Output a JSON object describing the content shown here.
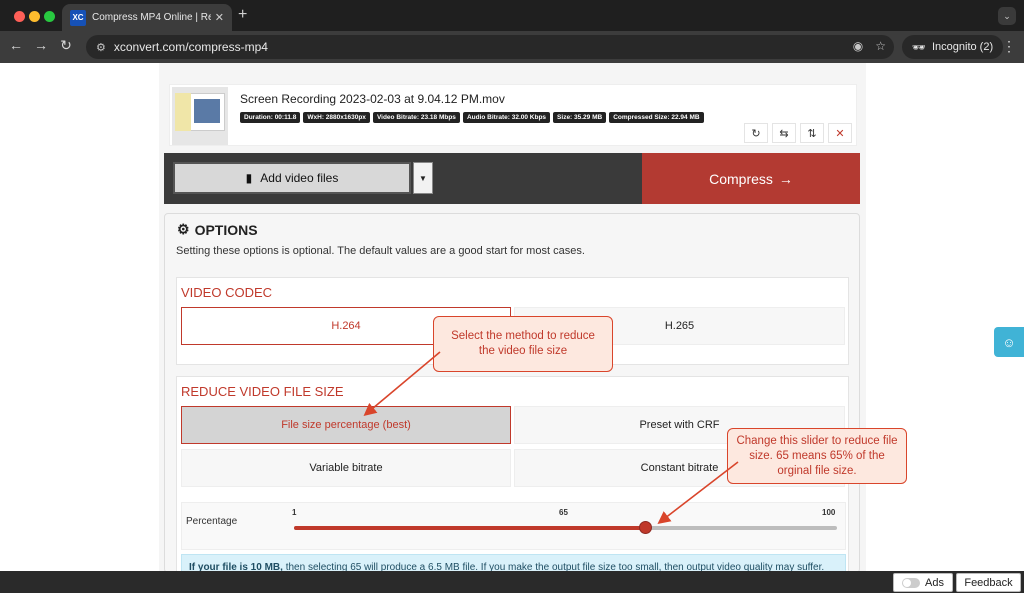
{
  "browser": {
    "tab_title": "Compress MP4 Online | Redu",
    "favicon_text": "XC",
    "url": "xconvert.com/compress-mp4",
    "incognito_label": "Incognito (2)"
  },
  "file": {
    "name": "Screen Recording 2023-02-03 at 9.04.12 PM.mov",
    "badges": [
      "Duration: 00:11.8",
      "WxH: 2880x1630px",
      "Video Bitrate: 23.18 Mbps",
      "Audio Bitrate: 32.00 Kbps",
      "Size: 35.29 MB",
      "Compressed Size: 22.94 MB"
    ]
  },
  "actions": {
    "add_label": "Add video files",
    "compress_label": "Compress"
  },
  "options": {
    "title": "OPTIONS",
    "subtitle": "Setting these options is optional. The default values are a good start for most cases.",
    "codec_title": "VIDEO CODEC",
    "codec_options": [
      "H.264",
      "H.265"
    ],
    "reduce_title": "REDUCE VIDEO FILE SIZE",
    "reduce_options": [
      "File size percentage (best)",
      "Preset with CRF",
      "Variable bitrate",
      "Constant bitrate"
    ],
    "slider": {
      "label": "Percentage",
      "min_label": "1",
      "mid_label": "65",
      "max_label": "100",
      "min": 1,
      "max": 100,
      "value": 65
    },
    "info_bold": "If your file is 10 MB,",
    "info_text": " then selecting 65 will produce a 6.5 MB file. If you make the output file size too small, then output video quality may suffer."
  },
  "annotations": {
    "callout_1": "Select the method to reduce the video file size",
    "callout_2": "Change this slider to reduce file size. 65 means 65% of the orginal file size."
  },
  "footer": {
    "ads_label": "Ads",
    "feedback_label": "Feedback"
  },
  "colors": {
    "accent": "#c0392b",
    "compress_bg": "#b33a32",
    "info_bg": "#d9f1fa"
  }
}
